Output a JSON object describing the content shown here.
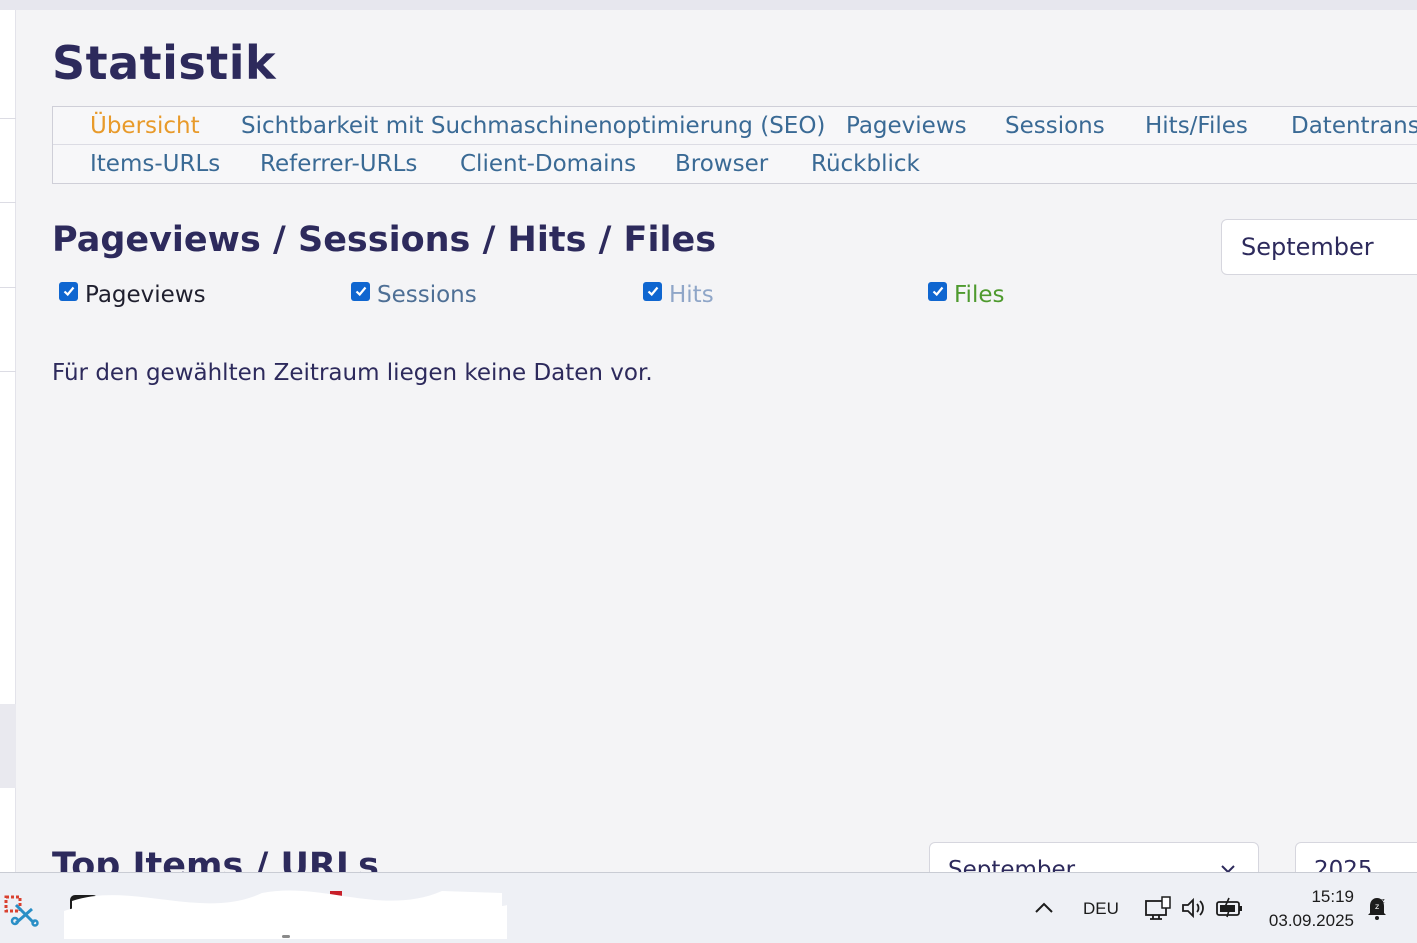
{
  "page": {
    "title": "Statistik"
  },
  "tabs": {
    "row1": [
      {
        "label": "Übersicht",
        "active": true
      },
      {
        "label": "Sichtbarkeit mit Suchmaschinenoptimierung (SEO)",
        "active": false
      },
      {
        "label": "Pageviews",
        "active": false
      },
      {
        "label": "Sessions",
        "active": false
      },
      {
        "label": "Hits/Files",
        "active": false
      },
      {
        "label": "Datentrans",
        "active": false
      }
    ],
    "row2": [
      {
        "label": "Items-URLs",
        "active": false
      },
      {
        "label": "Referrer-URLs",
        "active": false
      },
      {
        "label": "Client-Domains",
        "active": false
      },
      {
        "label": "Browser",
        "active": false
      },
      {
        "label": "Rückblick",
        "active": false
      }
    ]
  },
  "chart_section": {
    "title": "Pageviews / Sessions / Hits / Files",
    "month_select": "September",
    "checkboxes": [
      {
        "label": "Pageviews",
        "checked": true,
        "color": "#1f1f2e"
      },
      {
        "label": "Sessions",
        "checked": true,
        "color": "#4e6f95"
      },
      {
        "label": "Hits",
        "checked": true,
        "color": "#8fa6c8"
      },
      {
        "label": "Files",
        "checked": true,
        "color": "#4e9a2e"
      }
    ],
    "empty_message": "Für den gewählten Zeitraum liegen keine Daten vor."
  },
  "top_items": {
    "title": "Top Items / URLs",
    "month_select": "September",
    "year_select": "2025"
  },
  "taskbar": {
    "language": "DEU",
    "time": "15:19",
    "date": "03.09.2025",
    "icons": [
      "snipping-tool-icon",
      "chevron-up-icon",
      "network-icon",
      "volume-icon",
      "battery-icon",
      "notification-bell-icon"
    ]
  },
  "colors": {
    "accent_active_tab": "#e89a2a",
    "tab_link": "#3a6a95",
    "heading": "#2d2a5c",
    "checkbox": "#0f66d0"
  }
}
